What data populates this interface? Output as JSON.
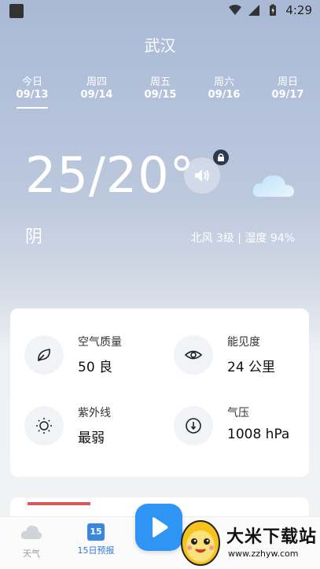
{
  "status_bar": {
    "time": "4:29"
  },
  "header": {
    "city": "武汉"
  },
  "days": [
    {
      "name": "今日",
      "date": "09/13"
    },
    {
      "name": "周四",
      "date": "09/14"
    },
    {
      "name": "周五",
      "date": "09/15"
    },
    {
      "name": "周六",
      "date": "09/16"
    },
    {
      "name": "周日",
      "date": "09/17"
    }
  ],
  "current": {
    "temperature": "25/20°",
    "condition": "阴",
    "wind_humidity": "北风 3级 | 湿度 94%"
  },
  "details": {
    "air_quality": {
      "label": "空气质量",
      "value": "50 良"
    },
    "visibility": {
      "label": "能见度",
      "value": "24 公里"
    },
    "uv": {
      "label": "紫外线",
      "value": "最弱"
    },
    "pressure": {
      "label": "气压",
      "value": "1008 hPa"
    }
  },
  "bottom_nav": {
    "weather": "天气",
    "forecast": "15日预报",
    "forecast_badge": "15"
  },
  "watermark": {
    "text": "大米下载站",
    "url": "www.zzhyw.com"
  },
  "colors": {
    "accent": "#2f95f5",
    "nav_active": "#2b7bd8"
  }
}
